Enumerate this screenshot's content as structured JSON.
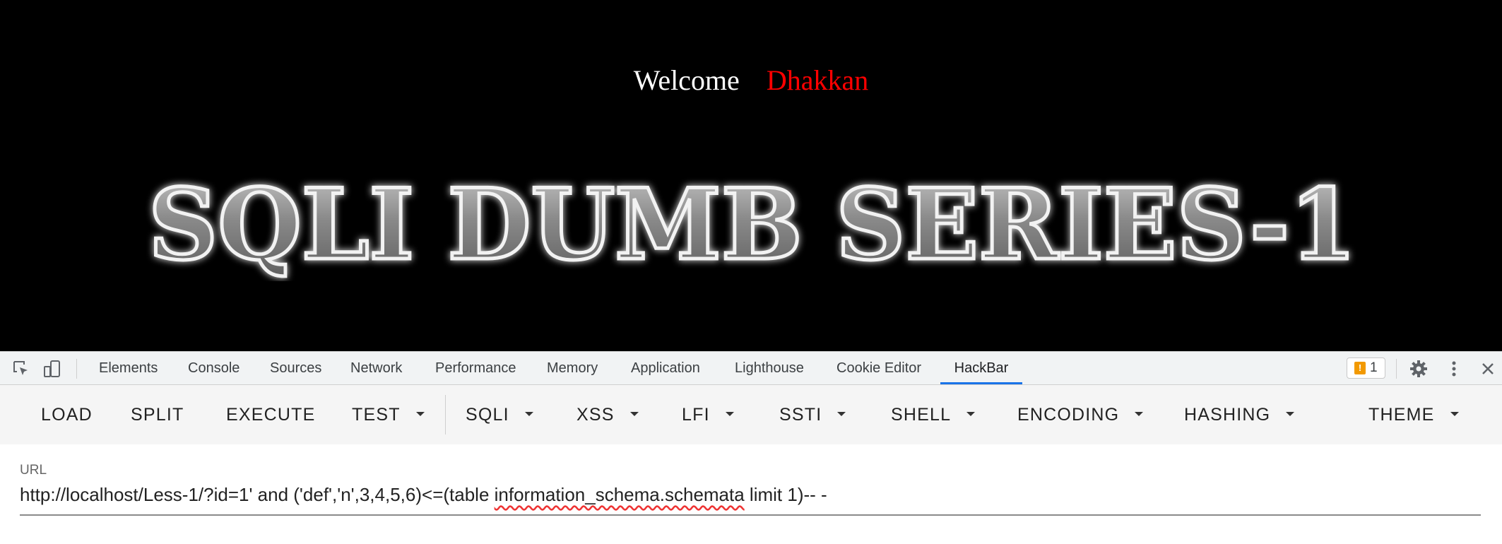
{
  "page": {
    "welcome_text": "Welcome",
    "user_name": "Dhakkan",
    "banner_text": "SQLI DUMB SERIES-1"
  },
  "devtools": {
    "tabs": [
      "Elements",
      "Console",
      "Sources",
      "Network",
      "Performance",
      "Memory",
      "Application",
      "Lighthouse",
      "Cookie Editor",
      "HackBar"
    ],
    "active_tab": "HackBar",
    "issues_count": "1",
    "icons": [
      "inspect-element-icon",
      "device-toolbar-icon",
      "settings-gear-icon",
      "more-vertical-icon",
      "close-icon"
    ]
  },
  "hackbar": {
    "buttons": [
      {
        "label": "LOAD",
        "dropdown": false
      },
      {
        "label": "SPLIT",
        "dropdown": false
      },
      {
        "label": "EXECUTE",
        "dropdown": false
      },
      {
        "label": "TEST",
        "dropdown": true
      },
      {
        "label": "SQLI",
        "dropdown": true
      },
      {
        "label": "XSS",
        "dropdown": true
      },
      {
        "label": "LFI",
        "dropdown": true
      },
      {
        "label": "SSTI",
        "dropdown": true
      },
      {
        "label": "SHELL",
        "dropdown": true
      },
      {
        "label": "ENCODING",
        "dropdown": true
      },
      {
        "label": "HASHING",
        "dropdown": true
      },
      {
        "label": "THEME",
        "dropdown": true
      }
    ],
    "url_label": "URL",
    "url_part1": "http://localhost/Less-1/?id=1' and ('def','n',3,4,5,6)<=(table ",
    "url_part2": "information_schema.schemata",
    "url_part3": " limit 1)-- -"
  },
  "colors": {
    "background": "#000000",
    "welcome": "#ffffff",
    "user_name": "#ff0000",
    "active_tab_underline": "#1a73e8",
    "warning": "#f29900"
  }
}
